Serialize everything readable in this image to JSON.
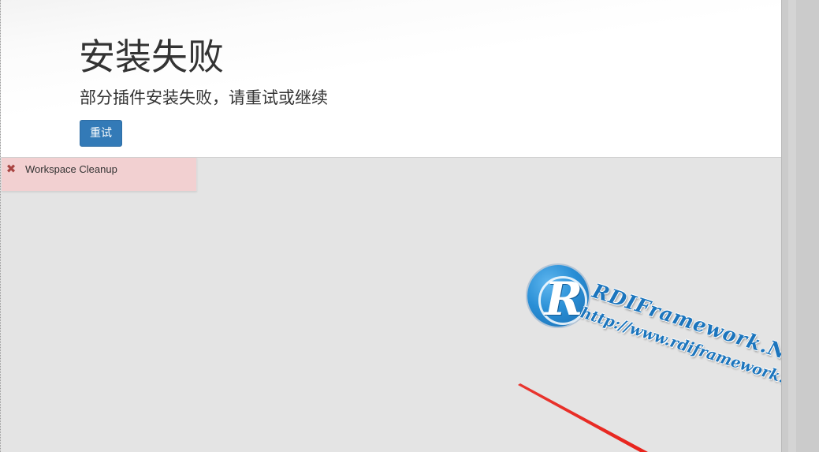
{
  "header": {
    "title": "安装失败",
    "subtitle": "部分插件安装失败，请重试或继续",
    "retry_label": "重试"
  },
  "plugins": [
    {
      "name": "Workspace Cleanup",
      "status": "failed",
      "status_icon": "cross-icon"
    }
  ],
  "watermark": {
    "name": "RDIFramework.NET",
    "url": "http://www.rdiframework.net",
    "logo_letter": "R",
    "logo_icon": "rdiframework-logo-icon"
  },
  "annotation": {
    "icon": "red-arrow",
    "color": "#e8231c"
  },
  "colors": {
    "primary_button": "#337ab7",
    "failed_item_bg": "#f2d0d1",
    "failed_icon": "#a94442",
    "watermark_blue": "#1c75bd"
  }
}
